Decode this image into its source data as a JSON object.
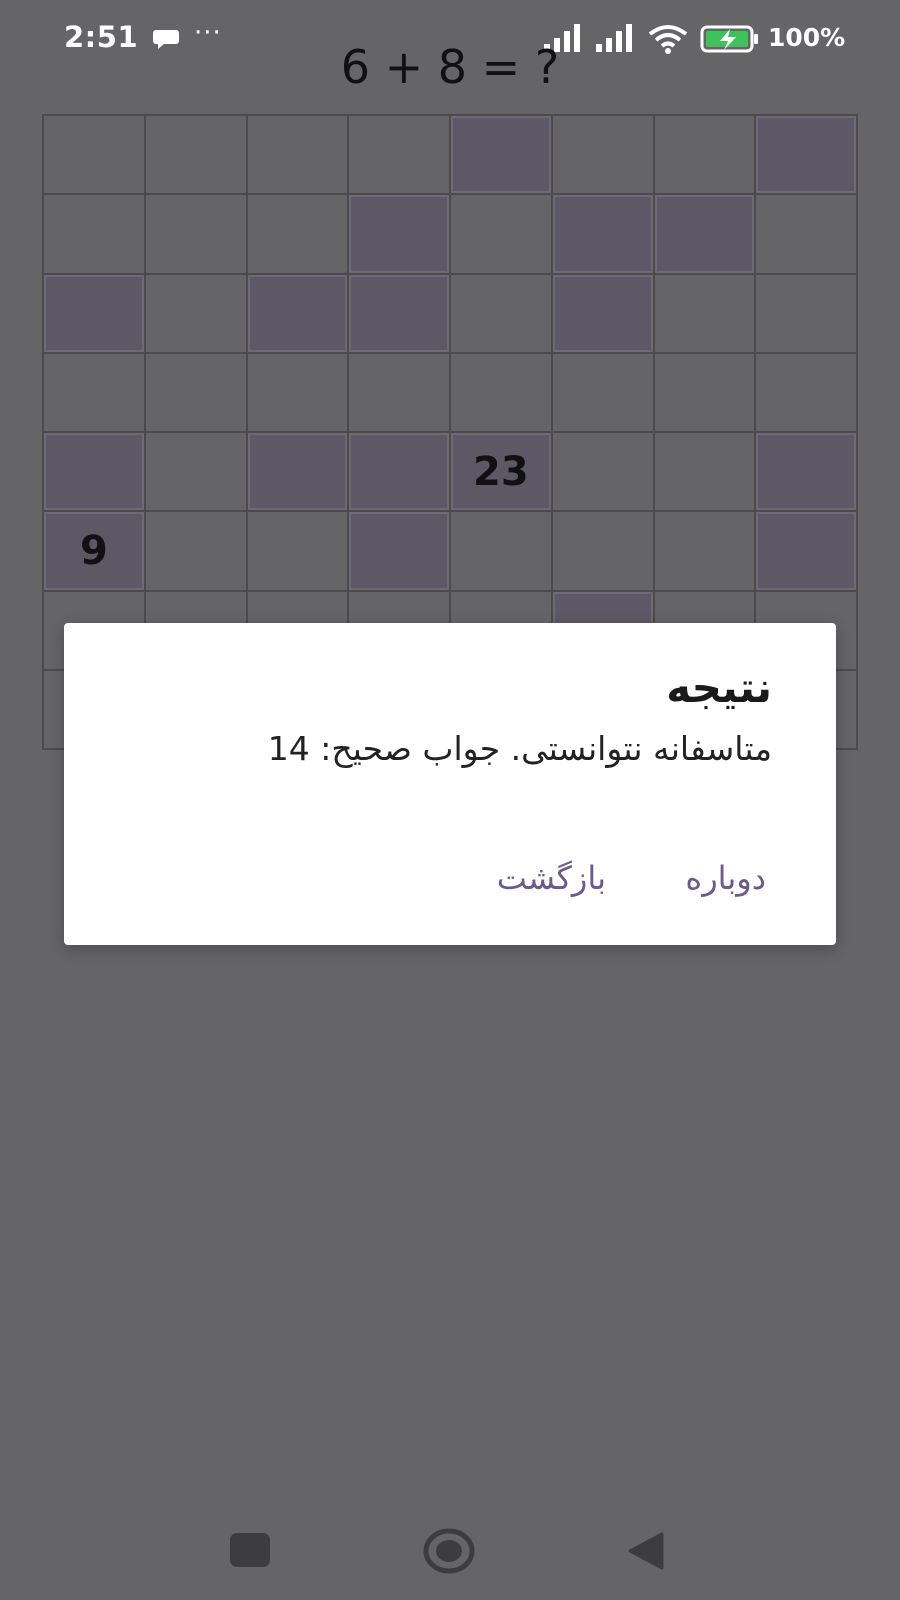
{
  "status_bar": {
    "time": "2:51",
    "more": "···",
    "battery_percent": "100%",
    "icons": [
      "chat-bubble-icon",
      "more-dots-icon",
      "signal-icon",
      "signal-icon",
      "wifi-icon",
      "battery-charging-icon"
    ]
  },
  "equation": "6 + 8 = ?",
  "grid": {
    "rows": 8,
    "cols": 8,
    "cells": [
      [
        {
          "dark": false,
          "label": ""
        },
        {
          "dark": false,
          "label": ""
        },
        {
          "dark": false,
          "label": ""
        },
        {
          "dark": false,
          "label": ""
        },
        {
          "dark": true,
          "label": ""
        },
        {
          "dark": false,
          "label": ""
        },
        {
          "dark": false,
          "label": ""
        },
        {
          "dark": true,
          "label": ""
        }
      ],
      [
        {
          "dark": false,
          "label": ""
        },
        {
          "dark": false,
          "label": ""
        },
        {
          "dark": false,
          "label": ""
        },
        {
          "dark": true,
          "label": ""
        },
        {
          "dark": false,
          "label": ""
        },
        {
          "dark": true,
          "label": ""
        },
        {
          "dark": true,
          "label": ""
        },
        {
          "dark": false,
          "label": ""
        }
      ],
      [
        {
          "dark": true,
          "label": ""
        },
        {
          "dark": false,
          "label": ""
        },
        {
          "dark": true,
          "label": ""
        },
        {
          "dark": true,
          "label": ""
        },
        {
          "dark": false,
          "label": ""
        },
        {
          "dark": true,
          "label": ""
        },
        {
          "dark": false,
          "label": ""
        },
        {
          "dark": false,
          "label": ""
        }
      ],
      [
        {
          "dark": false,
          "label": ""
        },
        {
          "dark": false,
          "label": ""
        },
        {
          "dark": false,
          "label": ""
        },
        {
          "dark": false,
          "label": ""
        },
        {
          "dark": false,
          "label": ""
        },
        {
          "dark": false,
          "label": ""
        },
        {
          "dark": false,
          "label": ""
        },
        {
          "dark": false,
          "label": ""
        }
      ],
      [
        {
          "dark": true,
          "label": ""
        },
        {
          "dark": false,
          "label": ""
        },
        {
          "dark": true,
          "label": ""
        },
        {
          "dark": true,
          "label": ""
        },
        {
          "dark": true,
          "label": "23"
        },
        {
          "dark": false,
          "label": ""
        },
        {
          "dark": false,
          "label": ""
        },
        {
          "dark": true,
          "label": ""
        }
      ],
      [
        {
          "dark": true,
          "label": "9"
        },
        {
          "dark": false,
          "label": ""
        },
        {
          "dark": false,
          "label": ""
        },
        {
          "dark": true,
          "label": ""
        },
        {
          "dark": false,
          "label": ""
        },
        {
          "dark": false,
          "label": ""
        },
        {
          "dark": false,
          "label": ""
        },
        {
          "dark": true,
          "label": ""
        }
      ],
      [
        {
          "dark": false,
          "label": ""
        },
        {
          "dark": false,
          "label": ""
        },
        {
          "dark": false,
          "label": ""
        },
        {
          "dark": false,
          "label": ""
        },
        {
          "dark": false,
          "label": ""
        },
        {
          "dark": true,
          "label": ""
        },
        {
          "dark": false,
          "label": ""
        },
        {
          "dark": false,
          "label": ""
        }
      ],
      [
        {
          "dark": false,
          "label": ""
        },
        {
          "dark": false,
          "label": ""
        },
        {
          "dark": false,
          "label": ""
        },
        {
          "dark": false,
          "label": ""
        },
        {
          "dark": false,
          "label": ""
        },
        {
          "dark": false,
          "label": ""
        },
        {
          "dark": false,
          "label": ""
        },
        {
          "dark": false,
          "label": ""
        }
      ]
    ]
  },
  "dialog": {
    "title": "نتیجه",
    "message": "متاسفانه نتوانستی. جواب صحیح: 14",
    "retry_label": "دوباره",
    "back_label": "بازگشت"
  },
  "nav_bar": {
    "icons": [
      "recents-square-icon",
      "home-circle-icon",
      "back-triangle-icon"
    ]
  },
  "colors": {
    "background": "#656467",
    "dark_cell": "#5c5866",
    "dialog_button": "#6a5a90"
  }
}
